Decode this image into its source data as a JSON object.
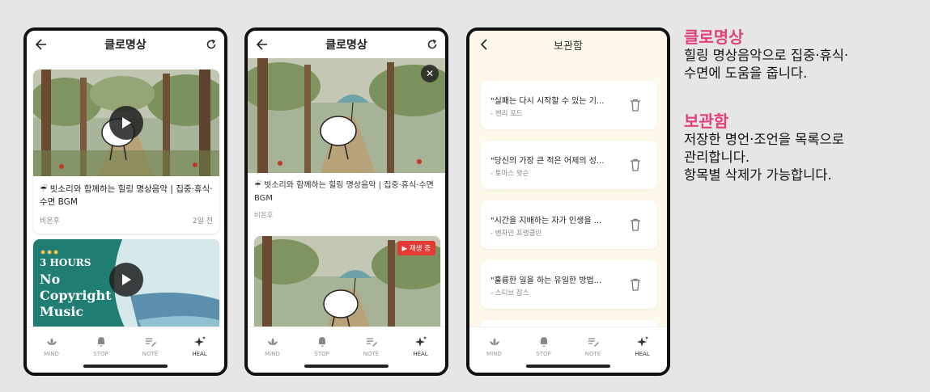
{
  "screen1": {
    "title": "클로명상",
    "videos": [
      {
        "title": "☔ 빗소리와 함께하는 힐링 명상음악 | 집중·휴식·수면 BGM",
        "channel": "비온후",
        "time": "2일 전"
      },
      {
        "overlay_top": "3 HOURS",
        "overlay_main": "No Copyright Music"
      }
    ]
  },
  "screen2": {
    "title": "클로명상",
    "player_video": {
      "title": "☔ 빗소리와 함께하는 힐링 명상음악 | 집중·휴식·수면 BGM",
      "channel": "비온후"
    },
    "playing_badge": "▶ 재생 중"
  },
  "screen3": {
    "title": "보관함",
    "quotes": [
      {
        "text": "\"실패는 다시 시작할 수 있는 기...",
        "author": "- 헨리 포드"
      },
      {
        "text": "\"당신의 가장 큰 적은 어제의 성...",
        "author": "- 토마스 왓슨"
      },
      {
        "text": "\"시간을 지배하는 자가 인생을 ...",
        "author": "- 벤자민 프랭클린"
      },
      {
        "text": "\"훌륭한 일을 하는 유일한 방법...",
        "author": "- 스티브 잡스"
      }
    ]
  },
  "tabs": [
    "MIND",
    "STOP",
    "NOTE",
    "HEAL"
  ],
  "descriptions": [
    {
      "heading": "클로명상",
      "lines": [
        "힐링 명상음악으로 집중·휴식·",
        "수면에 도움을 줍니다."
      ]
    },
    {
      "heading": "보관함",
      "lines": [
        "저장한 명언·조언을 목록으로",
        "관리합니다.",
        "항목별 삭제가 가능합니다."
      ]
    }
  ],
  "colors": {
    "accent": "#e0407b",
    "badge": "#e53935",
    "archive_bg": "#fdf8ea"
  }
}
